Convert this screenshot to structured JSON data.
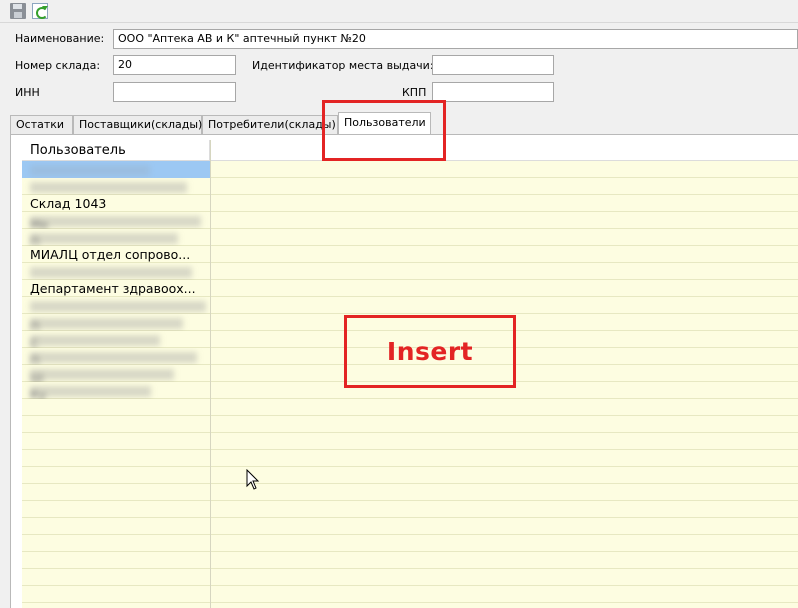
{
  "toolbar": {
    "save_icon": "save-icon",
    "refresh_icon": "refresh-icon"
  },
  "form": {
    "name_label": "Наименование:",
    "name_value": "ООО \"Аптека АВ и К\" аптечный пункт №20",
    "warehouse_label": "Номер склада:",
    "warehouse_value": "20",
    "issue_point_label": "Идентификатор места выдачи:",
    "issue_point_value": "",
    "inn_label": "ИНН",
    "inn_value": "",
    "kpp_label": "КПП",
    "kpp_value": ""
  },
  "tabs": [
    {
      "label": "Остатки"
    },
    {
      "label": "Поставщики(склады)"
    },
    {
      "label": "Потребители(склады)"
    },
    {
      "label": "Пользователи"
    }
  ],
  "active_tab": "Пользователи",
  "grid": {
    "column_header": "Пользователь",
    "rows": [
      {
        "text": "",
        "blurred": true,
        "selected": true
      },
      {
        "text": "",
        "blurred": true
      },
      {
        "text": "Склад 1043",
        "blurred": false
      },
      {
        "text": "Ме",
        "blurred": true
      },
      {
        "text": "П",
        "blurred": true
      },
      {
        "text": "МИАЛЦ отдел сопрово...",
        "blurred": false
      },
      {
        "text": "",
        "blurred": true
      },
      {
        "text": "Департамент здравоох...",
        "blurred": false
      },
      {
        "text": "",
        "blurred": true
      },
      {
        "text": "П",
        "blurred": true
      },
      {
        "text": "С",
        "blurred": true
      },
      {
        "text": "П",
        "blurred": true
      },
      {
        "text": "Ш",
        "blurred": true
      },
      {
        "text": "Ку",
        "blurred": true
      }
    ]
  },
  "annotation": {
    "insert_label": "Insert",
    "color": "#e32424"
  }
}
